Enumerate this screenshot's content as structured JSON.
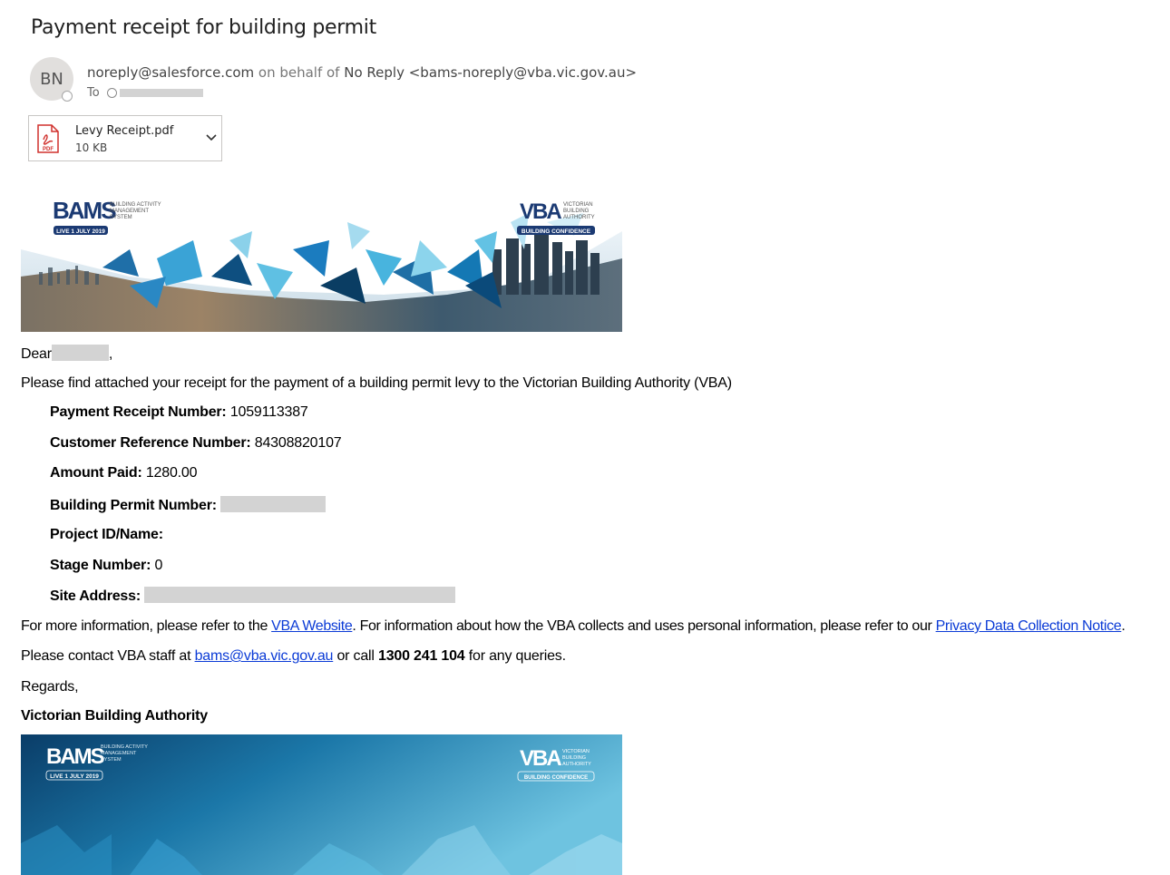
{
  "email": {
    "subject": "Payment receipt for building permit",
    "avatar_initials": "BN",
    "sender_address": "noreply@salesforce.com",
    "on_behalf_text": "on behalf of",
    "sender_display": "No Reply <bams-noreply@vba.vic.gov.au>",
    "to_label": "To"
  },
  "attachment": {
    "filename": "Levy Receipt.pdf",
    "size": "10 KB",
    "icon": "pdf-icon",
    "icon_text": "PDF"
  },
  "banner": {
    "bams_logo": "BAMS",
    "bams_tagline_1": "BUILDING ACTIVITY",
    "bams_tagline_2": "MANAGEMENT",
    "bams_tagline_3": "SYSTEM",
    "bams_badge": "LIVE 1 JULY 2019",
    "vba_logo": "VBA",
    "vba_tagline_1": "VICTORIAN",
    "vba_tagline_2": "BUILDING",
    "vba_tagline_3": "AUTHORITY",
    "vba_badge": "BUILDING CONFIDENCE"
  },
  "body": {
    "greeting": "Dear",
    "greeting_punct": ",",
    "intro": "Please find attached your receipt for the payment of a building permit levy to the Victorian Building Authority (VBA)",
    "fields": {
      "receipt_label": "Payment Receipt Number:",
      "receipt_value": "1059113387",
      "customer_ref_label": "Customer Reference Number:",
      "customer_ref_value": "84308820107",
      "amount_label": "Amount Paid:",
      "amount_value": "1280.00",
      "permit_label": "Building Permit Number:",
      "project_label": "Project ID/Name:",
      "stage_label": "Stage Number:",
      "stage_value": "0",
      "site_label": "Site Address:"
    },
    "info_pre": "For more information, please refer to the",
    "vba_website_link": "VBA Website",
    "info_mid": ". For information about how the VBA collects and uses personal information, please refer to our",
    "privacy_link": "Privacy Data Collection Notice",
    "info_end": ".",
    "contact_pre": "Please contact VBA staff at",
    "contact_email": "bams@vba.vic.gov.au",
    "contact_mid": "or call",
    "contact_phone": "1300 241 104",
    "contact_end": "for any queries.",
    "regards": "Regards,",
    "signature": "Victorian Building Authority"
  },
  "colors": {
    "link": "#0b3bd6",
    "pdf_red": "#d0312d",
    "banner_dark": "#0b4a7a",
    "banner_light": "#6ec3e0",
    "bams_navy": "#1b3a73"
  }
}
